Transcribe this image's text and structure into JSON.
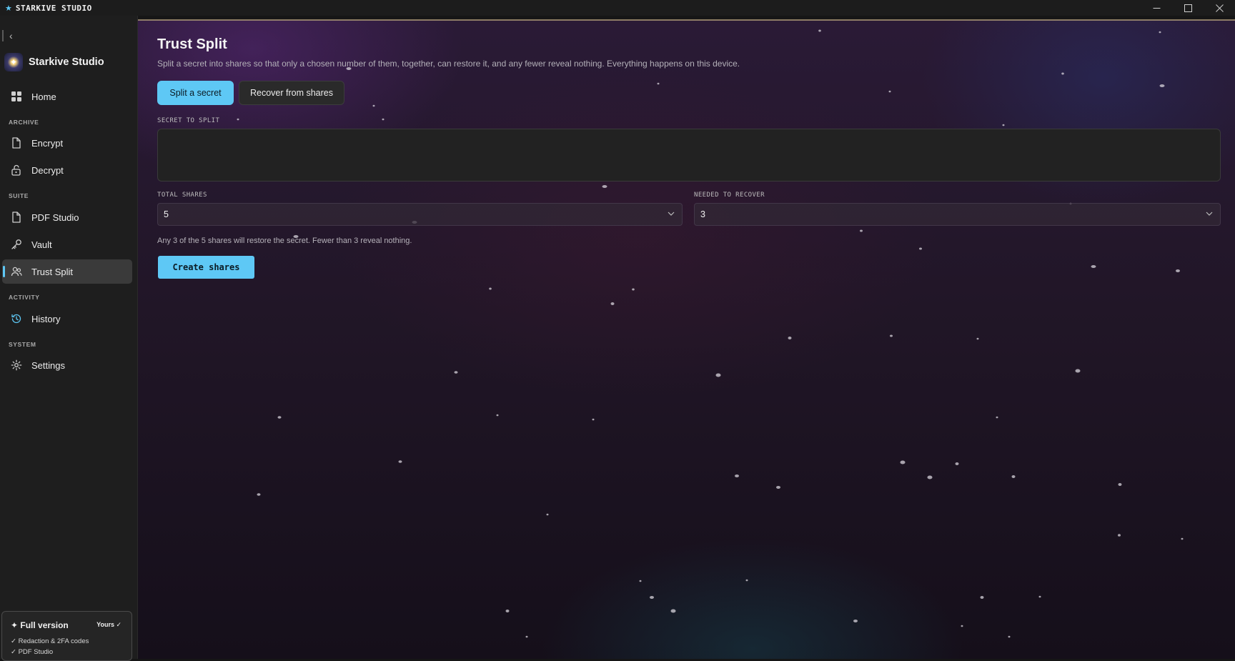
{
  "titlebar": {
    "app_name": "STARKIVE STUDIO",
    "minimize": "—",
    "maximize": "☐",
    "close": "✕"
  },
  "sidebar": {
    "brand": "Starkive Studio",
    "sections": {
      "archive": "ARCHIVE",
      "suite": "SUITE",
      "activity": "ACTIVITY",
      "system": "SYSTEM"
    },
    "items": {
      "home": "Home",
      "encrypt": "Encrypt",
      "decrypt": "Decrypt",
      "pdf_studio": "PDF Studio",
      "vault": "Vault",
      "trust_split": "Trust Split",
      "history": "History",
      "settings": "Settings"
    },
    "active_item": "Trust Split",
    "license": {
      "title": "✦ Full version",
      "badge": "Yours ✓",
      "features": [
        "✓ Redaction & 2FA codes",
        "✓ PDF Studio"
      ]
    }
  },
  "main": {
    "title": "Trust Split",
    "subtitle": "Split a secret into shares so that only a chosen number of them, together, can restore it, and any fewer reveal nothing. Everything happens on this device.",
    "tabs": {
      "split": "Split a secret",
      "recover": "Recover from shares"
    },
    "active_tab": "Split a secret",
    "secret_label": "SECRET TO SPLIT",
    "secret_value": "",
    "total_shares_label": "TOTAL SHARES",
    "total_shares_value": "5",
    "needed_label": "NEEDED TO RECOVER",
    "needed_value": "3",
    "hint": "Any 3 of the 5 shares will restore the secret. Fewer than 3 reveal nothing.",
    "create_button": "Create shares"
  },
  "colors": {
    "accent": "#5ec8f5",
    "sidebar_bg": "#1e1e1e",
    "active_nav_bg": "#3a3a3a"
  }
}
